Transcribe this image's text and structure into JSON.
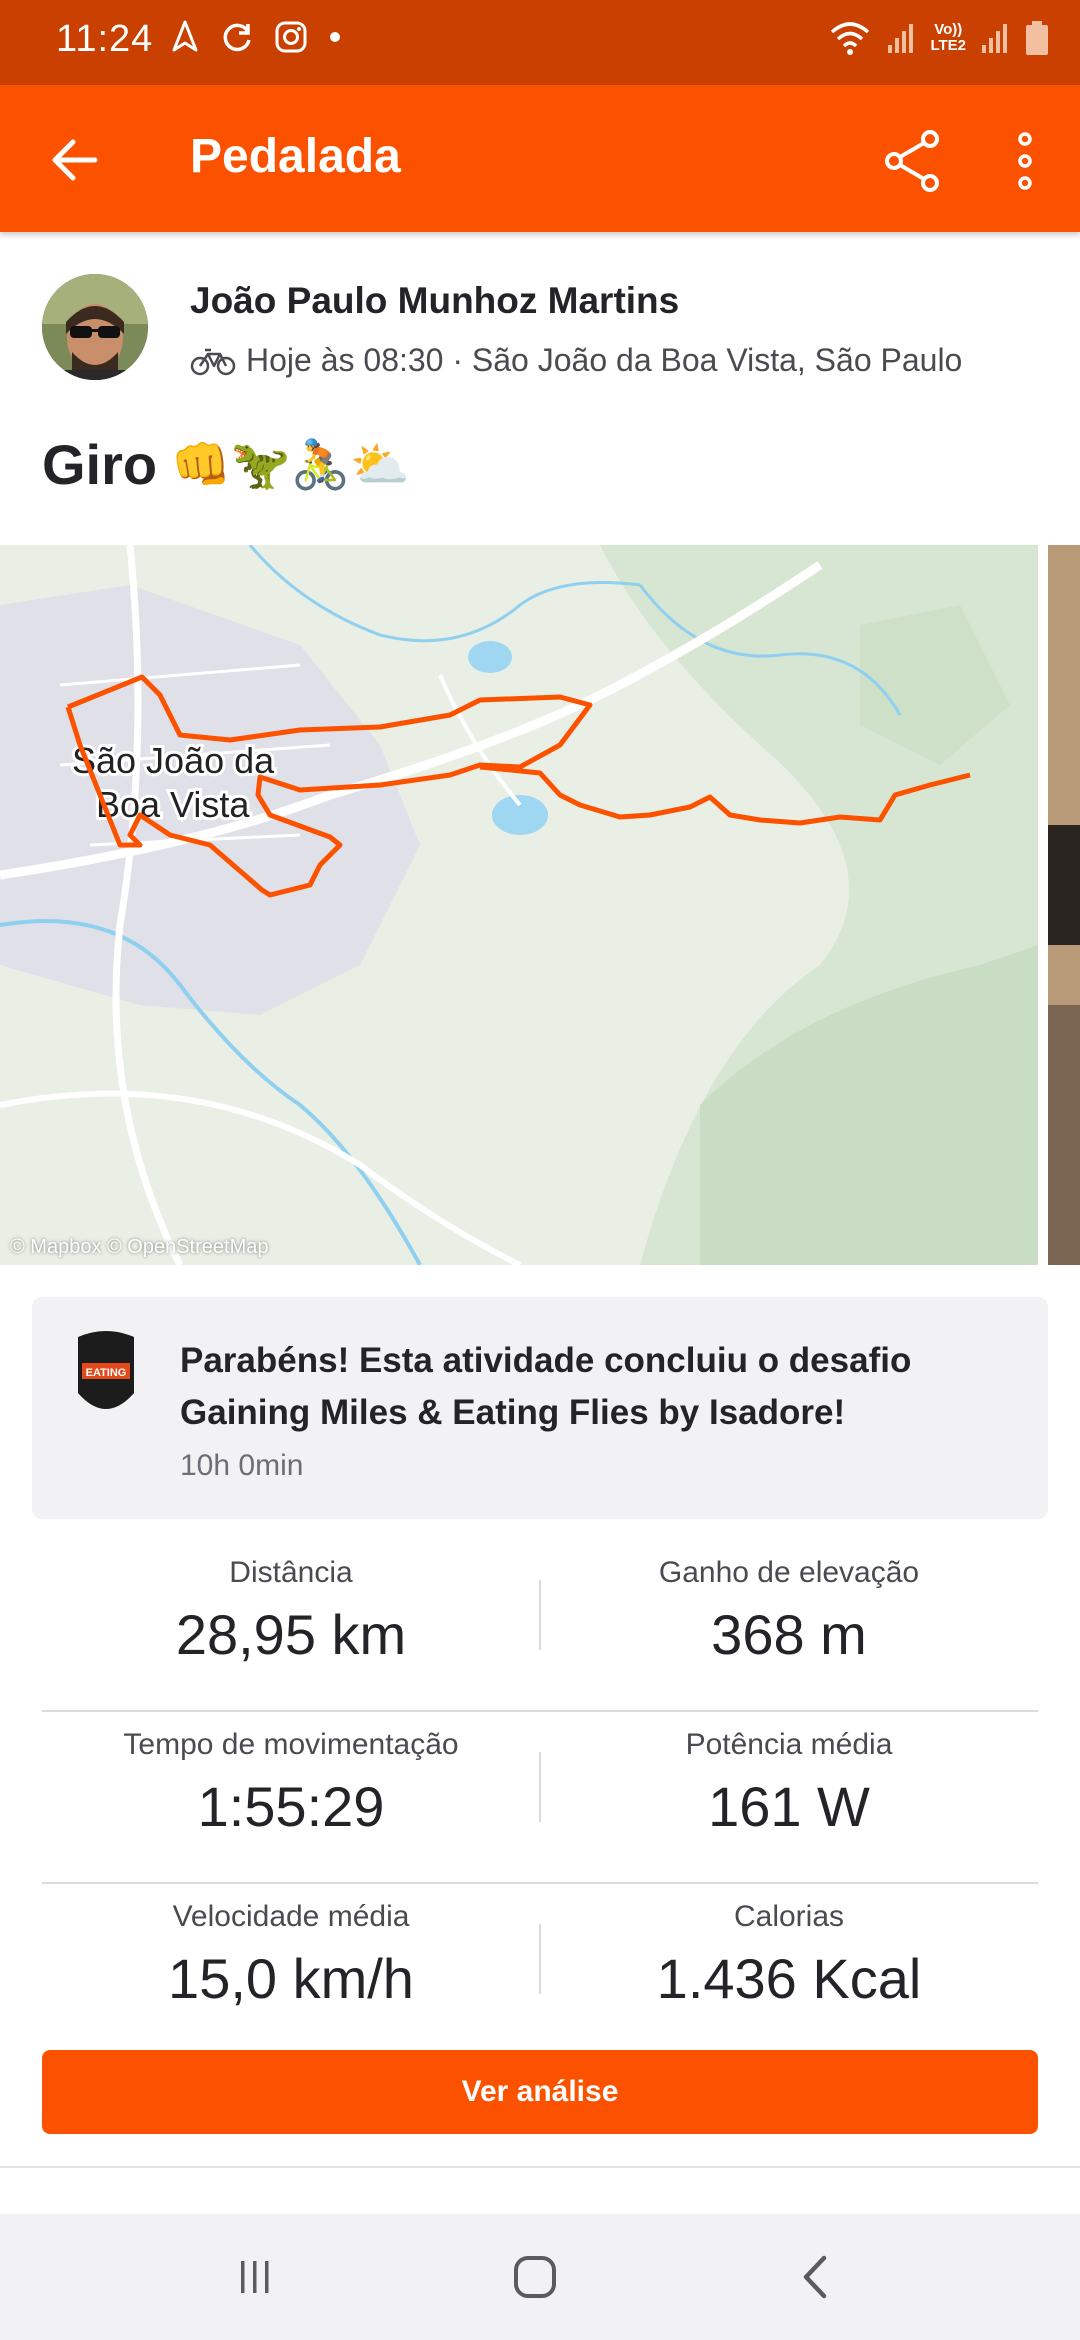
{
  "status_bar": {
    "time": "11:24",
    "icons_left": [
      "navigation-icon",
      "sync-icon",
      "instagram-icon",
      "dot-icon"
    ],
    "icons_right": [
      "wifi-icon",
      "signal-icon",
      "volte-icon",
      "signal-icon",
      "battery-icon"
    ],
    "volte_label": "Vo))",
    "lte_label": "LTE2"
  },
  "app_bar": {
    "title": "Pedalada",
    "back_icon": "arrow-left-icon",
    "share_icon": "share-icon",
    "more_icon": "more-vertical-icon"
  },
  "activity": {
    "athlete_name": "João Paulo Munhoz Martins",
    "sport_icon": "bike-icon",
    "meta": "Hoje às 08:30 · São João da Boa Vista, São Paulo",
    "title": "Giro",
    "title_emojis": "👊🦖🚴⛅"
  },
  "map": {
    "city_label_line1": "São João da",
    "city_label_line2": "Boa Vista",
    "attribution": "© Mapbox © OpenStreetMap",
    "route_color": "#fc5200"
  },
  "challenge": {
    "text": "Parabéns! Esta atividade concluiu o desafio Gaining Miles & Eating Flies by Isadore!",
    "time": "10h 0min",
    "badge_text": "EATING"
  },
  "stats": [
    [
      {
        "label": "Distância",
        "value": "28,95 km"
      },
      {
        "label": "Ganho de elevação",
        "value": "368 m"
      }
    ],
    [
      {
        "label": "Tempo de movimentação",
        "value": "1:55:29"
      },
      {
        "label": "Potência média",
        "value": "161 W"
      }
    ],
    [
      {
        "label": "Velocidade média",
        "value": "15,0 km/h"
      },
      {
        "label": "Calorias",
        "value": "1.436 Kcal"
      }
    ]
  ],
  "analysis_button": "Ver análise",
  "nav_bar": {
    "recents_icon": "recents-icon",
    "home_icon": "home-icon",
    "back_icon": "back-chevron-icon"
  },
  "colors": {
    "brand": "#fc5200",
    "status_bar": "#c94000"
  }
}
